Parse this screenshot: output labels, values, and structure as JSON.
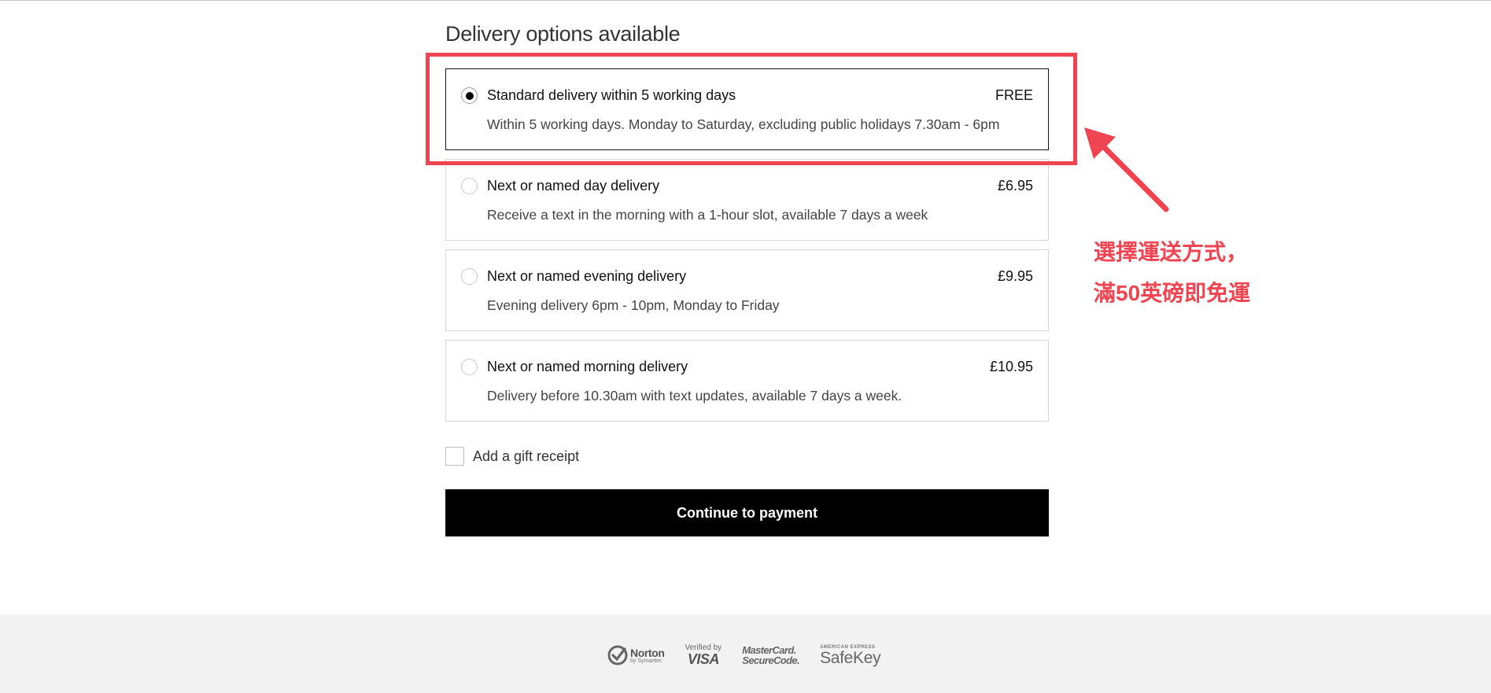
{
  "section": {
    "title": "Delivery options available"
  },
  "options": [
    {
      "title": "Standard delivery within 5 working days",
      "price": "FREE",
      "description": "Within 5 working days. Monday to Saturday, excluding public holidays 7.30am - 6pm",
      "selected": true
    },
    {
      "title": "Next or named day delivery",
      "price": "£6.95",
      "description": "Receive a text in the morning with a 1-hour slot, available 7 days a week",
      "selected": false
    },
    {
      "title": "Next or named evening delivery",
      "price": "£9.95",
      "description": "Evening delivery 6pm - 10pm, Monday to Friday",
      "selected": false
    },
    {
      "title": "Next or named morning delivery",
      "price": "£10.95",
      "description": "Delivery before 10.30am with text updates, available 7 days a week.",
      "selected": false
    }
  ],
  "gift_receipt": {
    "label": "Add a gift receipt",
    "checked": false
  },
  "continue_button": {
    "label": "Continue to payment"
  },
  "annotation": {
    "line1": "選擇運送方式，",
    "line2": "滿50英磅即免運",
    "color": "#ef4552"
  },
  "footer_badges": {
    "norton": {
      "name": "Norton",
      "sub": "by Symantec"
    },
    "visa": {
      "top": "Verified by",
      "name": "VISA"
    },
    "mastercard": {
      "line1": "MasterCard.",
      "line2": "SecureCode."
    },
    "amex": {
      "top": "AMERICAN EXPRESS",
      "name": "SafeKey"
    }
  },
  "colors": {
    "accent_annotation": "#ef4552",
    "button_bg": "#000000",
    "footer_bg": "#f2f2f2"
  }
}
